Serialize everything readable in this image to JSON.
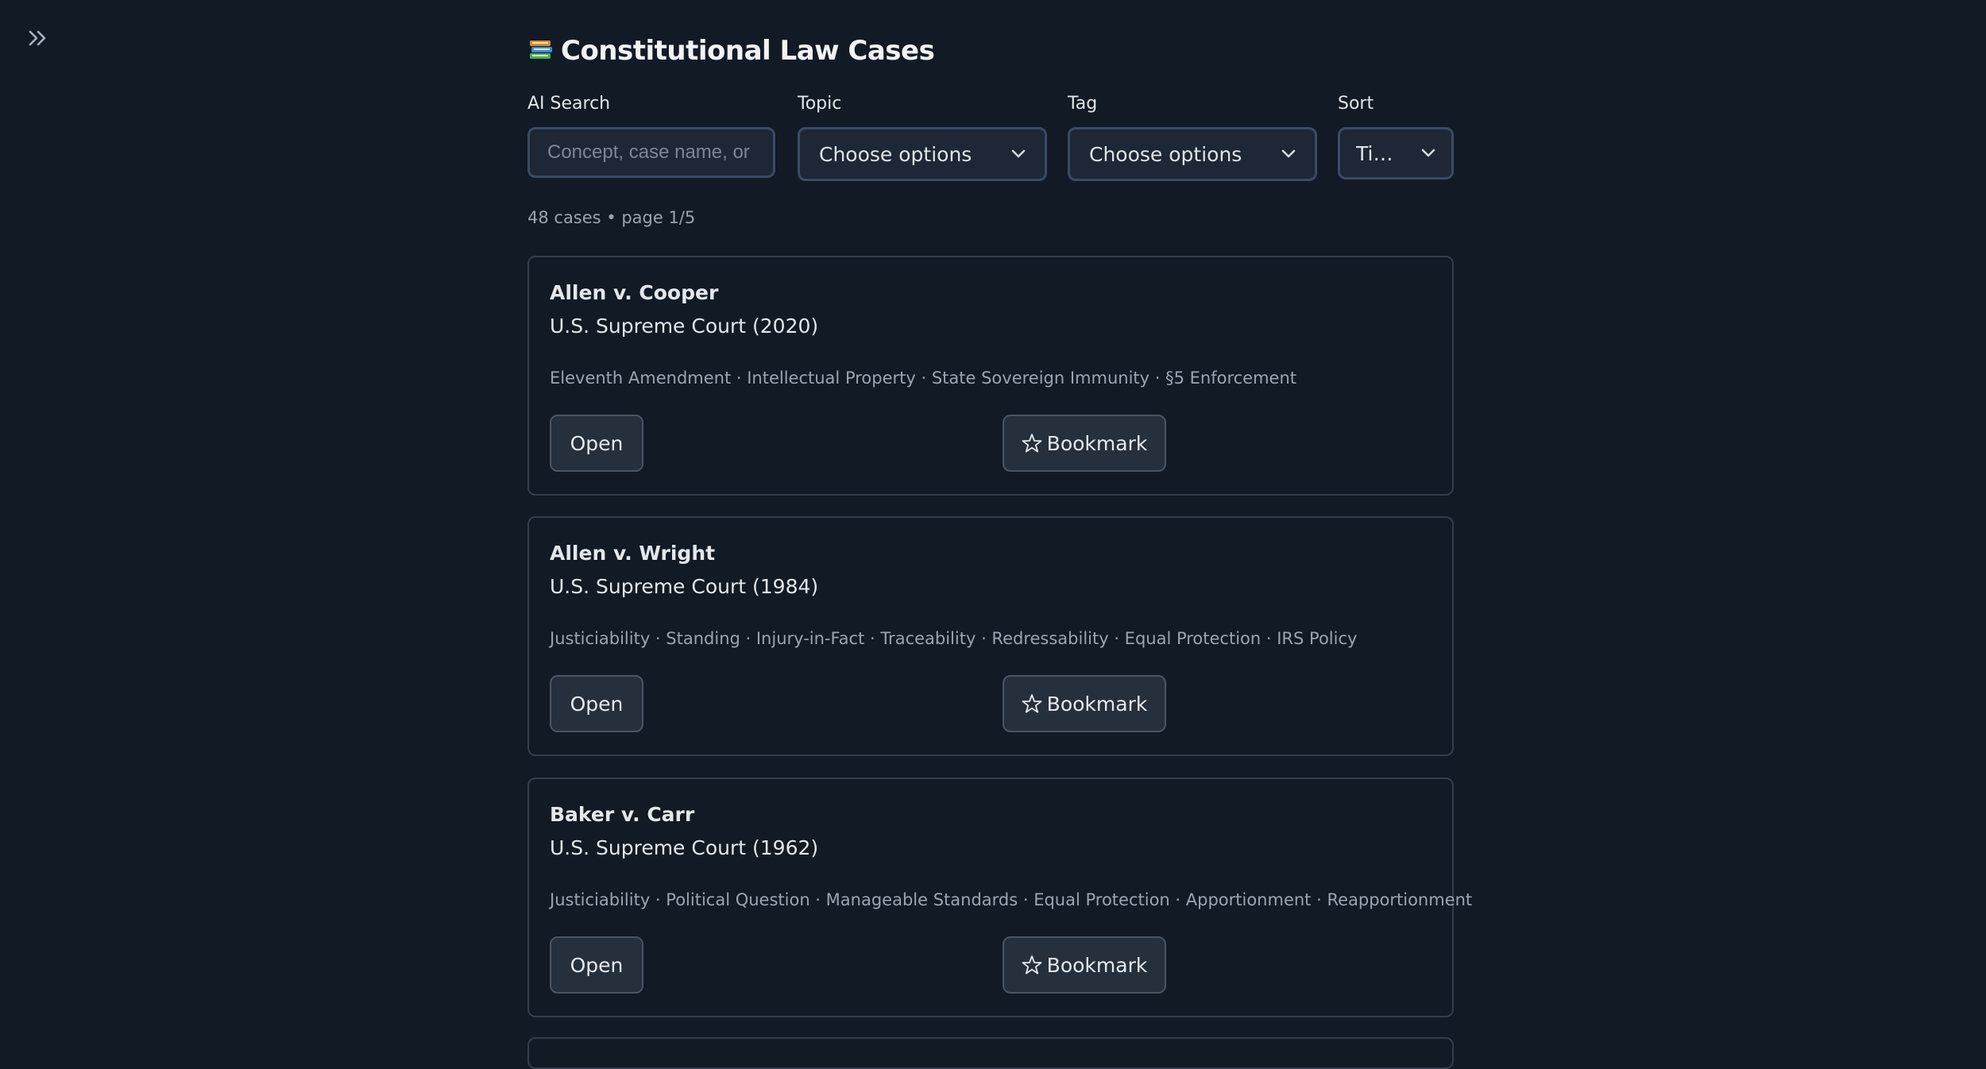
{
  "header": {
    "title": "Constitutional Law Cases",
    "icon": "books-icon"
  },
  "sidebar_toggle": {
    "icon": "double-chevron-right-icon"
  },
  "filters": {
    "search": {
      "label": "AI Search",
      "placeholder": "Concept, case name, or r",
      "value": ""
    },
    "topic": {
      "label": "Topic",
      "value": "Choose options"
    },
    "tag": {
      "label": "Tag",
      "value": "Choose options"
    },
    "sort": {
      "label": "Sort",
      "value": "Ti…"
    }
  },
  "results": {
    "summary": "48 cases • page 1/5"
  },
  "cases": [
    {
      "name": "Allen v. Cooper",
      "court": "U.S. Supreme Court (2020)",
      "tags": "Eleventh Amendment · Intellectual Property · State Sovereign Immunity · §5 Enforcement",
      "open_label": "Open",
      "bookmark_label": "Bookmark"
    },
    {
      "name": "Allen v. Wright",
      "court": "U.S. Supreme Court (1984)",
      "tags": "Justiciability · Standing · Injury-in-Fact · Traceability · Redressability · Equal Protection · IRS Policy",
      "open_label": "Open",
      "bookmark_label": "Bookmark"
    },
    {
      "name": "Baker v. Carr",
      "court": "U.S. Supreme Court (1962)",
      "tags": "Justiciability · Political Question · Manageable Standards · Equal Protection · Apportionment · Reapportionment",
      "open_label": "Open",
      "bookmark_label": "Bookmark"
    }
  ],
  "colors": {
    "background": "#111a25",
    "input_bg": "#1d2735",
    "input_border": "#3a4b63",
    "card_border": "#333e4d",
    "button_bg": "#262f3c",
    "muted_text": "#9ba4b0"
  }
}
